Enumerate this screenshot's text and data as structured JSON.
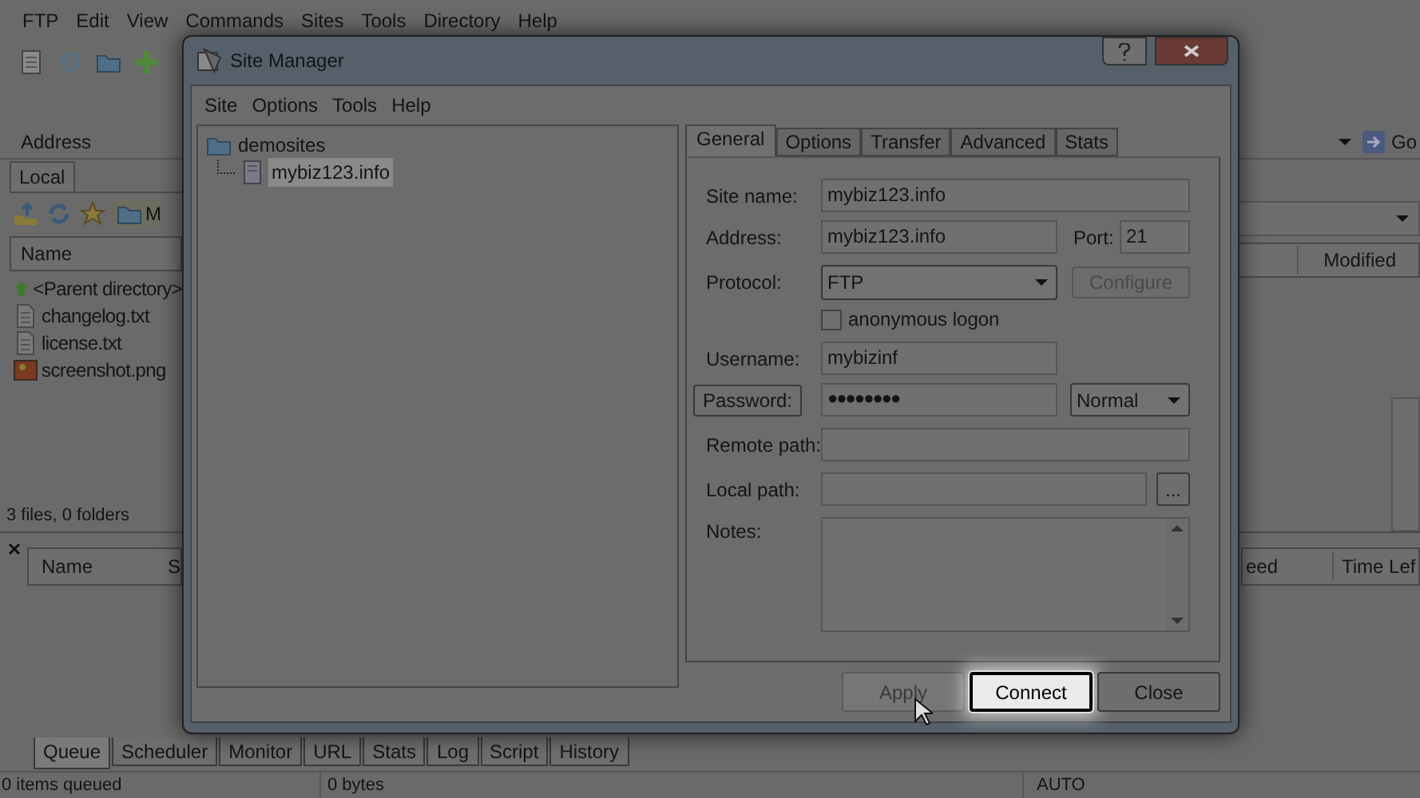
{
  "app": {
    "menu": [
      "FTP",
      "Edit",
      "View",
      "Commands",
      "Sites",
      "Tools",
      "Directory",
      "Help"
    ],
    "address_label": "Address",
    "go_label": "Go",
    "local": {
      "tab": "Local",
      "path": "M",
      "column": "Name",
      "files": [
        {
          "name": "<Parent directory>",
          "kind": "parent"
        },
        {
          "name": "changelog.txt",
          "kind": "text"
        },
        {
          "name": "license.txt",
          "kind": "text"
        },
        {
          "name": "screenshot.png",
          "kind": "image"
        }
      ],
      "status": "3 files, 0 folders"
    },
    "remote": {
      "column": "Modified"
    },
    "queue": {
      "columns": [
        "Name",
        "S",
        "eed",
        "Time Lef"
      ]
    },
    "bottom_tabs": [
      {
        "label": "Queue",
        "selected": true
      },
      {
        "label": "Scheduler",
        "selected": false
      },
      {
        "label": "Monitor",
        "selected": false
      },
      {
        "label": "URL",
        "selected": false
      },
      {
        "label": "Stats",
        "selected": false
      },
      {
        "label": "Log",
        "selected": false
      },
      {
        "label": "Script",
        "selected": false
      },
      {
        "label": "History",
        "selected": false
      }
    ],
    "status_bar": [
      "0 items queued",
      "0 bytes",
      "AUTO"
    ]
  },
  "dialog": {
    "title": "Site Manager",
    "menu": [
      "Site",
      "Options",
      "Tools",
      "Help"
    ],
    "tree": [
      {
        "label": "demosites",
        "kind": "folder",
        "selected": false,
        "children": [
          {
            "label": "mybiz123.info",
            "kind": "server",
            "selected": true
          }
        ]
      }
    ],
    "tabs": [
      {
        "label": "General",
        "selected": true
      },
      {
        "label": "Options",
        "selected": false
      },
      {
        "label": "Transfer",
        "selected": false
      },
      {
        "label": "Advanced",
        "selected": false
      },
      {
        "label": "Stats",
        "selected": false
      }
    ],
    "form": {
      "site_name": {
        "label": "Site name:",
        "value": "mybiz123.info"
      },
      "address": {
        "label": "Address:",
        "value": "mybiz123.info"
      },
      "port": {
        "label": "Port:",
        "value": "21"
      },
      "protocol": {
        "label": "Protocol:",
        "value": "FTP"
      },
      "configure": {
        "label": "Configure",
        "disabled": true
      },
      "anonymous": {
        "label": "anonymous logon",
        "checked": false
      },
      "username": {
        "label": "Username:",
        "value": "mybizinf"
      },
      "password": {
        "label": "Password:",
        "value": "●●●●●●●●"
      },
      "logon_type": {
        "value": "Normal"
      },
      "remote_path": {
        "label": "Remote path:"
      },
      "local_path": {
        "label": "Local path:"
      },
      "browse": {
        "label": "..."
      },
      "notes": {
        "label": "Notes:"
      }
    },
    "buttons": [
      {
        "label": "Apply",
        "disabled": true,
        "focused": false
      },
      {
        "label": "Connect",
        "disabled": false,
        "focused": true
      },
      {
        "label": "Close",
        "disabled": false,
        "focused": false
      }
    ]
  }
}
